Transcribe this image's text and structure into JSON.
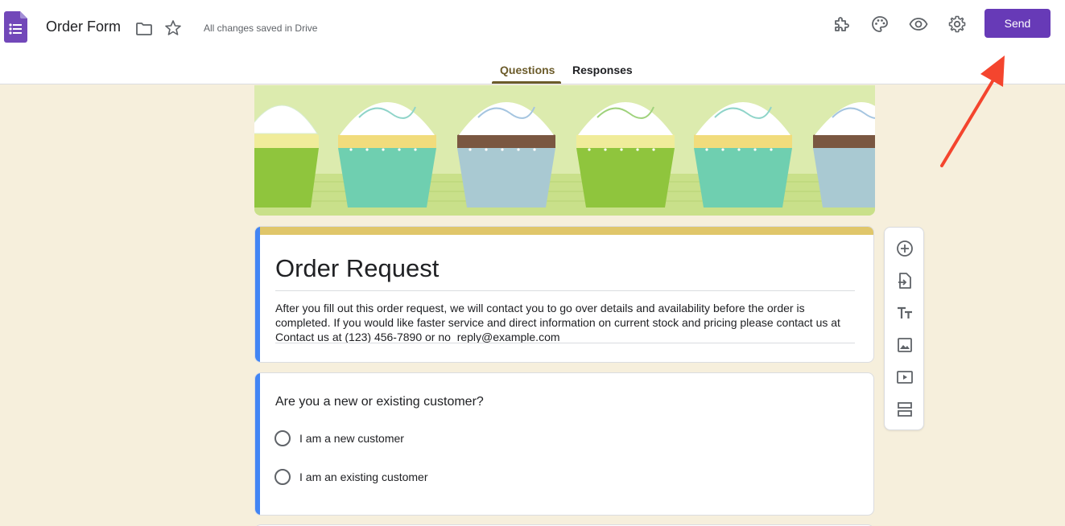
{
  "header": {
    "doc_title": "Order Form",
    "save_status": "All changes saved in Drive",
    "send_label": "Send",
    "icons": [
      "forms-logo-icon",
      "folder-icon",
      "star-icon",
      "addons-puzzle-icon",
      "palette-icon",
      "preview-eye-icon",
      "settings-gear-icon"
    ]
  },
  "tabs": [
    {
      "label": "Questions",
      "active": true
    },
    {
      "label": "Responses",
      "active": false
    }
  ],
  "form": {
    "title": "Order Request",
    "description": "After you fill out this order request, we will contact you to go over details and availability before the order is completed. If you would like faster service and direct information on current stock and pricing please contact us at Contact us at (123) 456-7890 or no_reply@example.com"
  },
  "question": {
    "text": "Are you a new or existing customer?",
    "options": [
      "I am a new customer",
      "I am an existing customer"
    ]
  },
  "toolbar": {
    "items": [
      "add-question-icon",
      "import-questions-icon",
      "add-title-icon",
      "add-image-icon",
      "add-video-icon",
      "add-section-icon"
    ]
  },
  "colors": {
    "accent": "#673ab7",
    "background": "#f6efdc",
    "theme_strip": "#e0c66a",
    "active_accent": "#4285f4",
    "annotation_arrow": "#f4452e"
  }
}
